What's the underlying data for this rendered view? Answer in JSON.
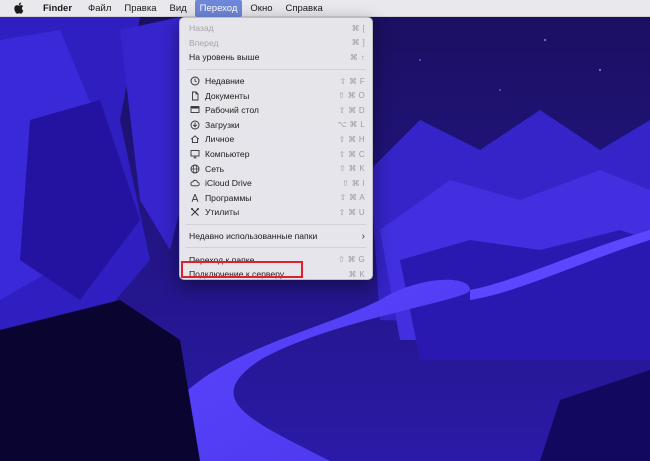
{
  "menubar": {
    "apple_icon": "apple-logo-icon",
    "items": [
      "Finder",
      "Файл",
      "Правка",
      "Вид",
      "Переход",
      "Окно",
      "Справка"
    ]
  },
  "go_menu": {
    "items": [
      {
        "label": "Назад",
        "shortcut": "⌘ [",
        "disabled": true
      },
      {
        "label": "Вперед",
        "shortcut": "⌘ ]",
        "disabled": true
      },
      {
        "label": "На уровень выше",
        "shortcut": "⌘ ↑"
      },
      {
        "label": "Недавние",
        "shortcut": "⇧ ⌘ F",
        "icon": "clock-icon"
      },
      {
        "label": "Документы",
        "shortcut": "⇧ ⌘ O",
        "icon": "document-icon"
      },
      {
        "label": "Рабочий стол",
        "shortcut": "⇧ ⌘ D",
        "icon": "desktop-icon"
      },
      {
        "label": "Загрузки",
        "shortcut": "⌥ ⌘ L",
        "icon": "download-icon"
      },
      {
        "label": "Личное",
        "shortcut": "⇧ ⌘ H",
        "icon": "home-icon"
      },
      {
        "label": "Компьютер",
        "shortcut": "⇧ ⌘ C",
        "icon": "computer-icon"
      },
      {
        "label": "Сеть",
        "shortcut": "⇧ ⌘ K",
        "icon": "network-icon"
      },
      {
        "label": "iCloud Drive",
        "shortcut": "⇧ ⌘ I",
        "icon": "cloud-icon"
      },
      {
        "label": "Программы",
        "shortcut": "⇧ ⌘ A",
        "icon": "applications-icon"
      },
      {
        "label": "Утилиты",
        "shortcut": "⇧ ⌘ U",
        "icon": "utilities-icon"
      },
      {
        "label": "Недавно использованные папки",
        "submenu_icon": "chevron-right-icon"
      },
      {
        "label": "Переход к папке...",
        "shortcut": "⇧ ⌘ G"
      },
      {
        "label": "Подключение к серверу...",
        "shortcut": "⌘ K"
      }
    ]
  },
  "colors": {
    "highlight": "#e0202a",
    "active_menu": "#6f87d9",
    "wallpaper_dark": "#1b0f66",
    "wallpaper_light": "#3b2ad6"
  }
}
